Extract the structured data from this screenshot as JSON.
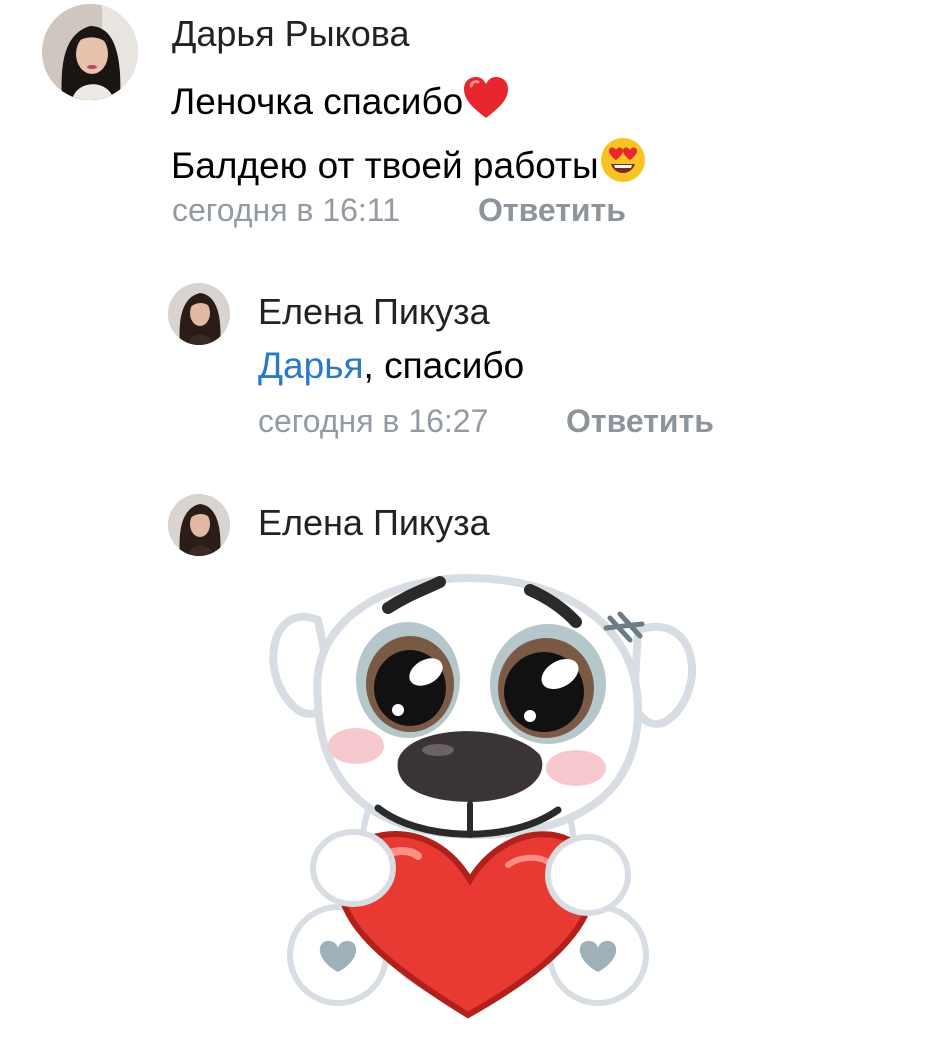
{
  "comments": [
    {
      "author": "Дарья Рыкова",
      "lines": [
        "Леночка спасибо",
        "Балдею от твоей работы"
      ],
      "line_emojis": [
        "heart-emoji",
        "heart-eyes-emoji"
      ],
      "time": "сегодня в 16:11",
      "reply_label": "Ответить"
    },
    {
      "author": "Елена Пикуза",
      "mention": "Дарья",
      "text": ", спасибо",
      "time": "сегодня в 16:27",
      "reply_label": "Ответить"
    },
    {
      "author": "Елена Пикуза",
      "sticker": "dog-holding-heart-sticker"
    }
  ]
}
